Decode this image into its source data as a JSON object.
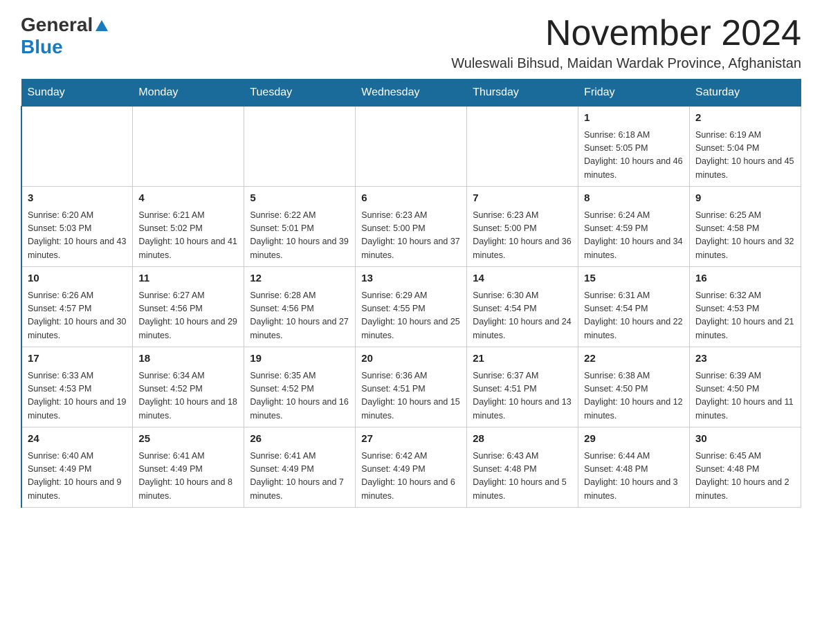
{
  "header": {
    "logo_general": "General",
    "logo_blue": "Blue",
    "month_year": "November 2024",
    "location": "Wuleswali Bihsud, Maidan Wardak Province, Afghanistan"
  },
  "calendar": {
    "days_of_week": [
      "Sunday",
      "Monday",
      "Tuesday",
      "Wednesday",
      "Thursday",
      "Friday",
      "Saturday"
    ],
    "weeks": [
      [
        {
          "day": "",
          "info": ""
        },
        {
          "day": "",
          "info": ""
        },
        {
          "day": "",
          "info": ""
        },
        {
          "day": "",
          "info": ""
        },
        {
          "day": "",
          "info": ""
        },
        {
          "day": "1",
          "info": "Sunrise: 6:18 AM\nSunset: 5:05 PM\nDaylight: 10 hours and 46 minutes."
        },
        {
          "day": "2",
          "info": "Sunrise: 6:19 AM\nSunset: 5:04 PM\nDaylight: 10 hours and 45 minutes."
        }
      ],
      [
        {
          "day": "3",
          "info": "Sunrise: 6:20 AM\nSunset: 5:03 PM\nDaylight: 10 hours and 43 minutes."
        },
        {
          "day": "4",
          "info": "Sunrise: 6:21 AM\nSunset: 5:02 PM\nDaylight: 10 hours and 41 minutes."
        },
        {
          "day": "5",
          "info": "Sunrise: 6:22 AM\nSunset: 5:01 PM\nDaylight: 10 hours and 39 minutes."
        },
        {
          "day": "6",
          "info": "Sunrise: 6:23 AM\nSunset: 5:00 PM\nDaylight: 10 hours and 37 minutes."
        },
        {
          "day": "7",
          "info": "Sunrise: 6:23 AM\nSunset: 5:00 PM\nDaylight: 10 hours and 36 minutes."
        },
        {
          "day": "8",
          "info": "Sunrise: 6:24 AM\nSunset: 4:59 PM\nDaylight: 10 hours and 34 minutes."
        },
        {
          "day": "9",
          "info": "Sunrise: 6:25 AM\nSunset: 4:58 PM\nDaylight: 10 hours and 32 minutes."
        }
      ],
      [
        {
          "day": "10",
          "info": "Sunrise: 6:26 AM\nSunset: 4:57 PM\nDaylight: 10 hours and 30 minutes."
        },
        {
          "day": "11",
          "info": "Sunrise: 6:27 AM\nSunset: 4:56 PM\nDaylight: 10 hours and 29 minutes."
        },
        {
          "day": "12",
          "info": "Sunrise: 6:28 AM\nSunset: 4:56 PM\nDaylight: 10 hours and 27 minutes."
        },
        {
          "day": "13",
          "info": "Sunrise: 6:29 AM\nSunset: 4:55 PM\nDaylight: 10 hours and 25 minutes."
        },
        {
          "day": "14",
          "info": "Sunrise: 6:30 AM\nSunset: 4:54 PM\nDaylight: 10 hours and 24 minutes."
        },
        {
          "day": "15",
          "info": "Sunrise: 6:31 AM\nSunset: 4:54 PM\nDaylight: 10 hours and 22 minutes."
        },
        {
          "day": "16",
          "info": "Sunrise: 6:32 AM\nSunset: 4:53 PM\nDaylight: 10 hours and 21 minutes."
        }
      ],
      [
        {
          "day": "17",
          "info": "Sunrise: 6:33 AM\nSunset: 4:53 PM\nDaylight: 10 hours and 19 minutes."
        },
        {
          "day": "18",
          "info": "Sunrise: 6:34 AM\nSunset: 4:52 PM\nDaylight: 10 hours and 18 minutes."
        },
        {
          "day": "19",
          "info": "Sunrise: 6:35 AM\nSunset: 4:52 PM\nDaylight: 10 hours and 16 minutes."
        },
        {
          "day": "20",
          "info": "Sunrise: 6:36 AM\nSunset: 4:51 PM\nDaylight: 10 hours and 15 minutes."
        },
        {
          "day": "21",
          "info": "Sunrise: 6:37 AM\nSunset: 4:51 PM\nDaylight: 10 hours and 13 minutes."
        },
        {
          "day": "22",
          "info": "Sunrise: 6:38 AM\nSunset: 4:50 PM\nDaylight: 10 hours and 12 minutes."
        },
        {
          "day": "23",
          "info": "Sunrise: 6:39 AM\nSunset: 4:50 PM\nDaylight: 10 hours and 11 minutes."
        }
      ],
      [
        {
          "day": "24",
          "info": "Sunrise: 6:40 AM\nSunset: 4:49 PM\nDaylight: 10 hours and 9 minutes."
        },
        {
          "day": "25",
          "info": "Sunrise: 6:41 AM\nSunset: 4:49 PM\nDaylight: 10 hours and 8 minutes."
        },
        {
          "day": "26",
          "info": "Sunrise: 6:41 AM\nSunset: 4:49 PM\nDaylight: 10 hours and 7 minutes."
        },
        {
          "day": "27",
          "info": "Sunrise: 6:42 AM\nSunset: 4:49 PM\nDaylight: 10 hours and 6 minutes."
        },
        {
          "day": "28",
          "info": "Sunrise: 6:43 AM\nSunset: 4:48 PM\nDaylight: 10 hours and 5 minutes."
        },
        {
          "day": "29",
          "info": "Sunrise: 6:44 AM\nSunset: 4:48 PM\nDaylight: 10 hours and 3 minutes."
        },
        {
          "day": "30",
          "info": "Sunrise: 6:45 AM\nSunset: 4:48 PM\nDaylight: 10 hours and 2 minutes."
        }
      ]
    ]
  }
}
